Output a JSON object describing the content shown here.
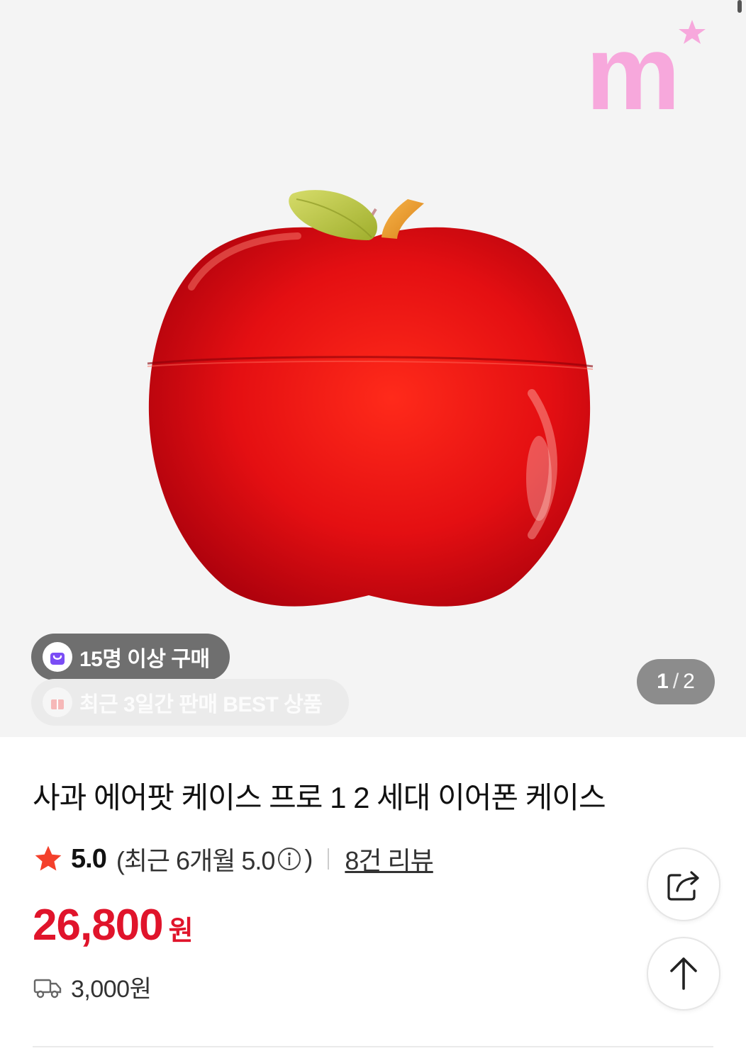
{
  "gallery": {
    "logo_text": "m",
    "page_current": "1",
    "page_separator": "/",
    "page_total": "2",
    "badges": [
      {
        "label": "15명 이상 구매",
        "icon": "shopping-bag-icon",
        "color": "#7b4df5"
      },
      {
        "label": "최근 3일간 판매 BEST 상품",
        "icon": "gift-icon"
      }
    ]
  },
  "product": {
    "title": "사과 에어팟 케이스 프로 1 2 세대 이어폰 케이스",
    "rating": "5.0",
    "rating_recent": "(최근 6개월 5.0",
    "rating_recent_close": ")",
    "reviews": "8건 리뷰",
    "price": "26,800",
    "price_unit": "원",
    "shipping": "3,000원"
  },
  "actions": {
    "share_icon": "share-icon",
    "top_icon": "arrow-up-icon"
  },
  "colors": {
    "price": "#e0142b",
    "star": "#f4402b",
    "logo": "#f7a8dc"
  }
}
